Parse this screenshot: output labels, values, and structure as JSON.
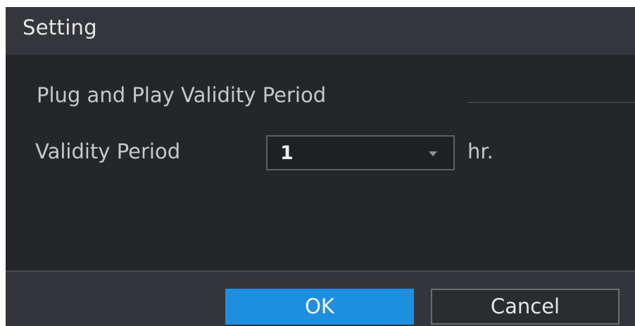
{
  "dialog": {
    "title": "Setting"
  },
  "section": {
    "title": "Plug and Play Validity Period"
  },
  "validity_period": {
    "label": "Validity Period",
    "selected_value": "1",
    "unit": "hr."
  },
  "buttons": {
    "ok_label": "OK",
    "cancel_label": "Cancel"
  },
  "colors": {
    "accent": "#1e8fe0",
    "dialog_background": "#25262a",
    "title_bar": "#34363b"
  },
  "icons": {
    "dropdown": "dropdown-arrow-icon"
  }
}
